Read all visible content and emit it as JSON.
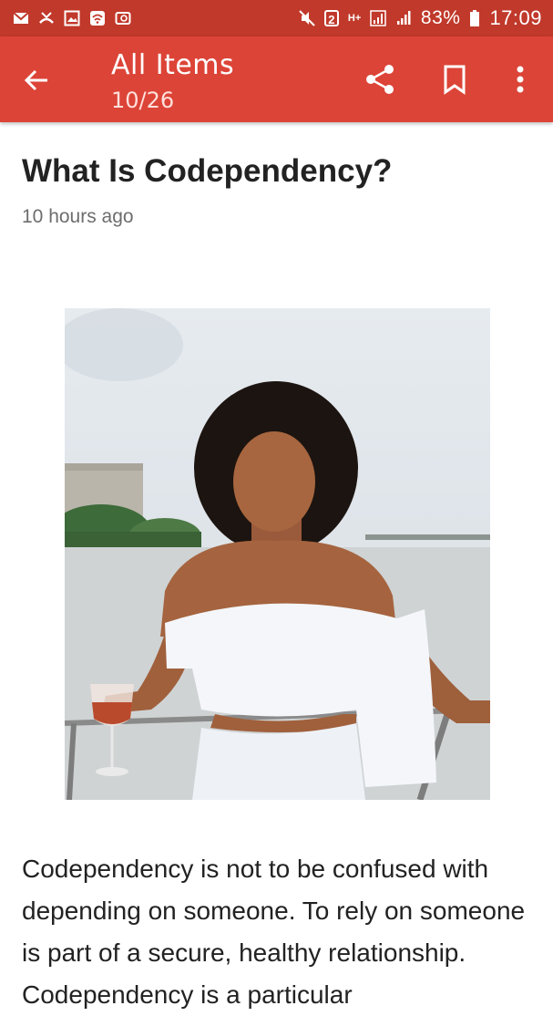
{
  "status_bar": {
    "battery_percent": "83%",
    "time": "17:09",
    "sim_badge": "2",
    "network_label": "H+",
    "icons": [
      "email-icon",
      "missed-call-icon",
      "gallery-icon",
      "wifi-icon",
      "screencast-icon",
      "mute-icon",
      "signal-icon",
      "battery-icon"
    ]
  },
  "app_bar": {
    "title": "All Items",
    "subtitle": "10/26",
    "back_icon": "arrow-back-icon",
    "actions": [
      "share-icon",
      "bookmark-icon",
      "more-vert-icon"
    ]
  },
  "article": {
    "title": "What Is Codependency?",
    "timestamp": "10 hours ago",
    "body": "Codependency is not to be confused with depending on someone. To rely on someone is part of a secure, healthy relationship. Codependency is a particular"
  },
  "colors": {
    "status_bar": "#c0392b",
    "app_bar": "#dc4437"
  }
}
